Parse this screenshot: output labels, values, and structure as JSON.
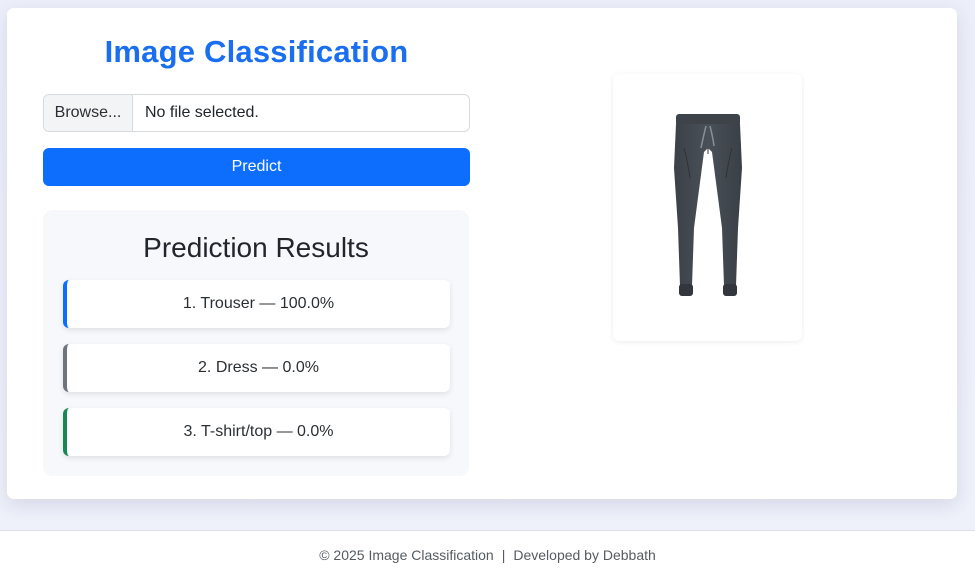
{
  "header": {
    "title": "Image Classification"
  },
  "upload": {
    "browse_label": "Browse...",
    "file_status": "No file selected."
  },
  "predict": {
    "label": "Predict"
  },
  "results": {
    "title": "Prediction Results",
    "items": [
      {
        "text": "1. Trouser — 100.0%",
        "accent": "#0d6efd"
      },
      {
        "text": "2. Dress — 0.0%",
        "accent": "#6c757d"
      },
      {
        "text": "3. T-shirt/top — 0.0%",
        "accent": "#198754"
      }
    ]
  },
  "preview": {
    "icon": "trouser-image"
  },
  "footer": {
    "copyright": "© 2025 Image Classification",
    "separator": "|",
    "credit": "Developed by Debbath"
  },
  "colors": {
    "primary": "#0d6efd",
    "title": "#1a6ef0",
    "panel": "#f6f8fc"
  }
}
